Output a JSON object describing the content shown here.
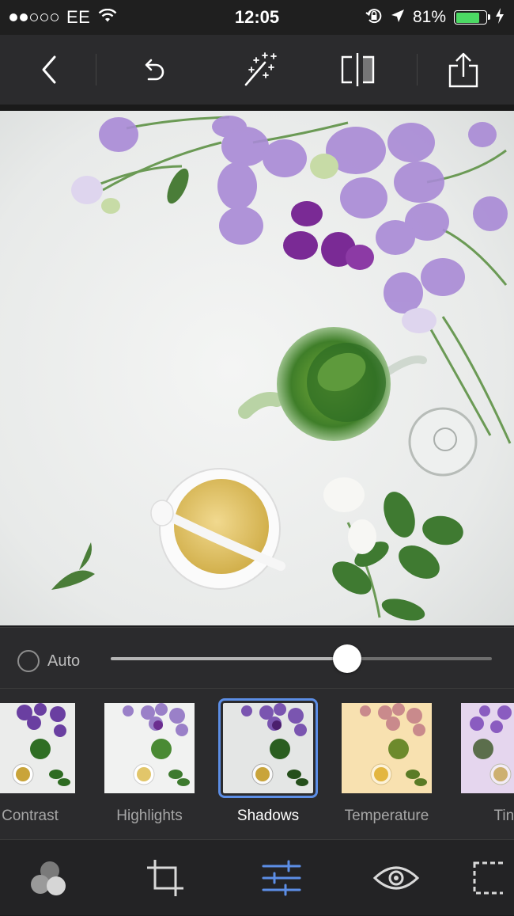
{
  "status_bar": {
    "signal_dots_filled": 2,
    "signal_dots_total": 5,
    "carrier": "EE",
    "time": "12:05",
    "battery_percent": "81%",
    "battery_level": 0.81,
    "battery_color": "#4cd964",
    "icons": [
      "wifi-icon",
      "orientation-lock-icon",
      "location-arrow-icon",
      "charging-bolt-icon"
    ]
  },
  "toolbar": {
    "buttons": [
      "back-chevron-icon",
      "undo-icon",
      "magic-wand-icon",
      "compare-icon",
      "share-icon"
    ]
  },
  "adjustment": {
    "auto_label": "Auto",
    "auto_enabled": false,
    "slider_value": 0.62
  },
  "adjustments": {
    "items": [
      {
        "label": "Contrast",
        "selected": false
      },
      {
        "label": "Highlights",
        "selected": false
      },
      {
        "label": "Shadows",
        "selected": true
      },
      {
        "label": "Temperature",
        "selected": false
      },
      {
        "label": "Tint",
        "selected": false
      }
    ],
    "selected_color": "#5c8ee6"
  },
  "tabbar": {
    "tabs": [
      "presets-icon",
      "crop-icon",
      "adjust-sliders-icon",
      "eye-icon",
      "vignette-icon"
    ],
    "active_tab": "adjust-sliders-icon",
    "active_color": "#5c8ee6"
  }
}
